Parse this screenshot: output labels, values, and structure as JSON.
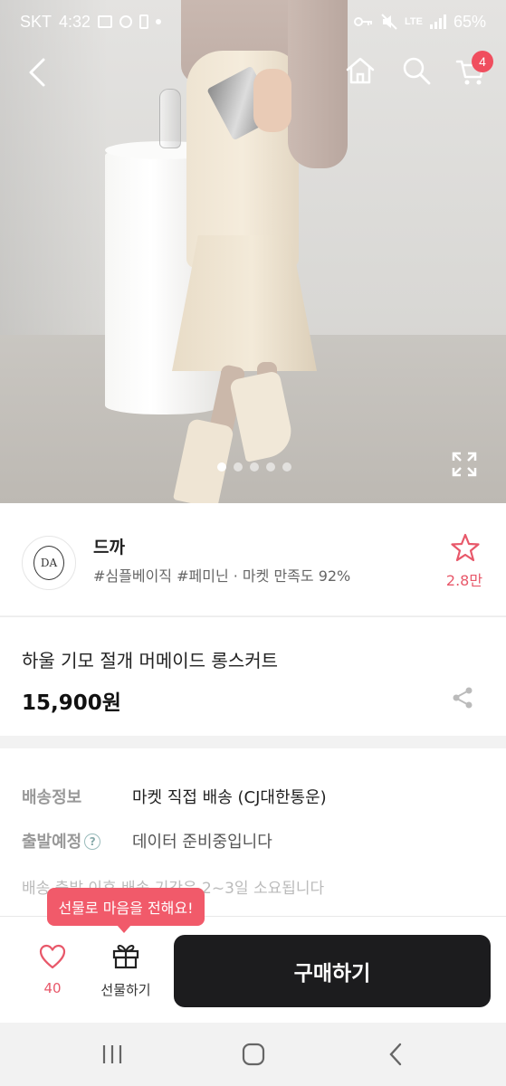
{
  "status_bar": {
    "carrier": "SKT",
    "time": "4:32",
    "network": "LTE",
    "battery": "65%",
    "colors": {
      "text": "#ffffff"
    }
  },
  "header": {
    "cart_count": "4",
    "icons": [
      "back-arrow-icon",
      "home-icon",
      "search-icon",
      "cart-icon"
    ],
    "colors": {
      "badge": "#f04e5e"
    }
  },
  "gallery": {
    "image_count": 5,
    "active_index": 0
  },
  "store": {
    "name": "드까",
    "tags": "#심플베이직 #페미닌 · 마켓 만족도 92%",
    "logo_text": "DA",
    "favorite_count": "2.8만",
    "colors": {
      "accent": "#e8586a"
    }
  },
  "product": {
    "title": "하울 기모 절개 머메이드 롱스커트",
    "price": "15,900원"
  },
  "shipping": {
    "rows": [
      {
        "label": "배송정보",
        "value": "마켓 직접 배송 (CJ대한통운)"
      },
      {
        "label": "출발예정",
        "value": "데이터 준비중입니다"
      }
    ],
    "note": "배송 출발 이후 배송 기간은 2~3일 소요됩니다"
  },
  "action_bar": {
    "like_count": "40",
    "gift_label": "선물하기",
    "gift_tooltip": "선물로 마음을 전해요!",
    "buy_label": "구매하기",
    "colors": {
      "buy": "#1c1c1e",
      "tooltip": "#f15a6a",
      "like": "#e8586a"
    }
  }
}
